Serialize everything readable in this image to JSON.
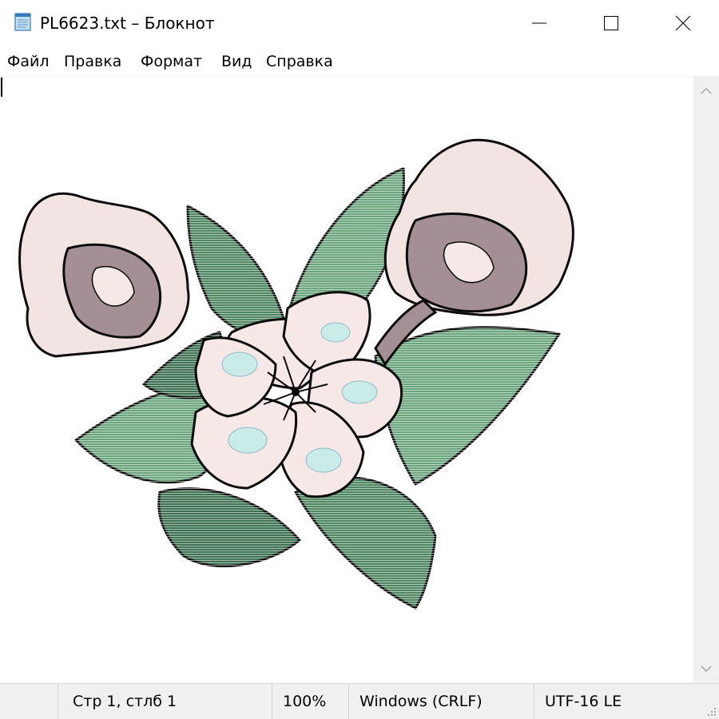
{
  "window": {
    "title": "PL6623.txt – Блокнот",
    "icon": "notepad-icon"
  },
  "menu": {
    "items": [
      "Файл",
      "Правка",
      "Формат",
      "Вид",
      "Справка"
    ]
  },
  "status": {
    "position": "Стр 1, стлб 1",
    "zoom": "100%",
    "line_ending": "Windows (CRLF)",
    "encoding": "UTF-16 LE"
  },
  "colors": {
    "leaf": "#6aa57d",
    "leaf_dark": "#3b6a4d",
    "petal": "#f7e8e8",
    "petal_shade": "#9f8d91",
    "center": "#c9ece8"
  }
}
